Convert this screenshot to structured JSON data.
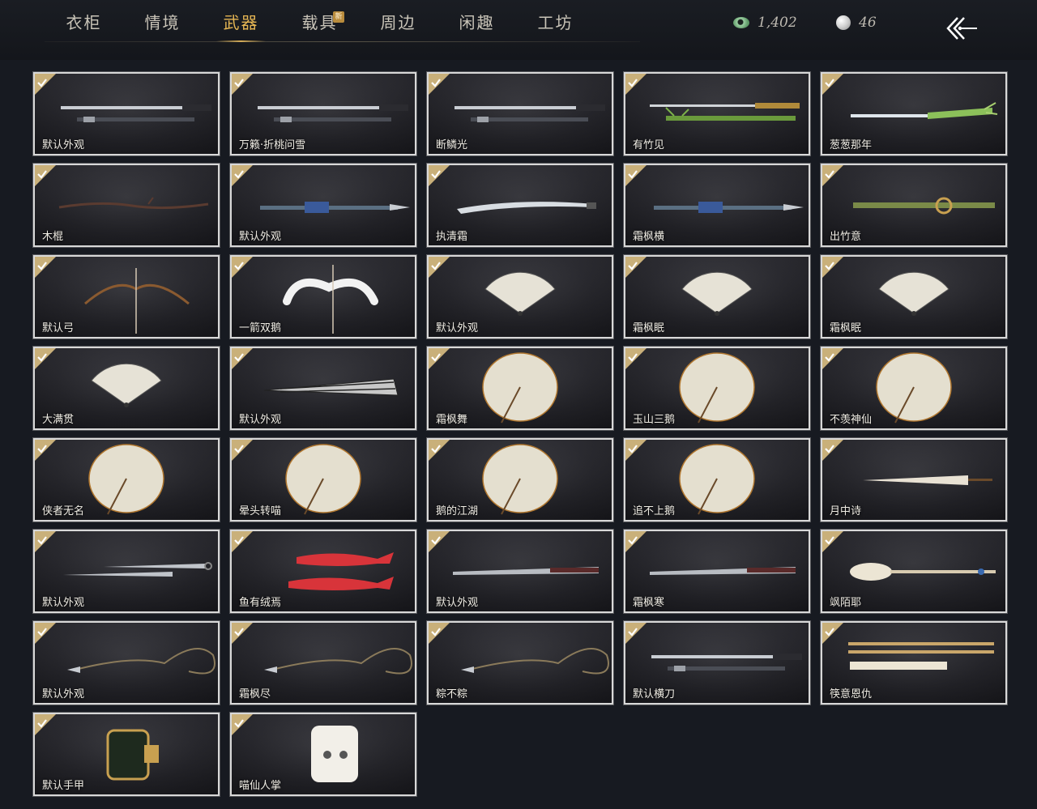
{
  "nav": {
    "tabs": [
      {
        "label": "衣柜"
      },
      {
        "label": "情境"
      },
      {
        "label": "武器"
      },
      {
        "label": "载具"
      },
      {
        "label": "周边"
      },
      {
        "label": "闲趣"
      },
      {
        "label": "工坊"
      }
    ],
    "active_index": 2,
    "new_badge": "新"
  },
  "currency": {
    "jade": "1,402",
    "pearl": "46"
  },
  "colors": {
    "accent": "#e6b653",
    "check": "#c9b07a",
    "card_border": "#d8d8d8"
  },
  "items": [
    {
      "name": "默认外观",
      "icon": "sword-icon"
    },
    {
      "name": "万籁·折桃问雪",
      "icon": "sword-icon"
    },
    {
      "name": "断鳞光",
      "icon": "sword-icon"
    },
    {
      "name": "有竹见",
      "icon": "bamboo-sword-icon"
    },
    {
      "name": "葱葱那年",
      "icon": "scallion-sword-icon"
    },
    {
      "name": "木棍",
      "icon": "stick-icon"
    },
    {
      "name": "默认外观",
      "icon": "spear-icon"
    },
    {
      "name": "执清霜",
      "icon": "frost-blade-icon"
    },
    {
      "name": "霜枫横",
      "icon": "spear-icon"
    },
    {
      "name": "出竹意",
      "icon": "bamboo-staff-icon"
    },
    {
      "name": "默认弓",
      "icon": "bow-icon"
    },
    {
      "name": "一箭双鹅",
      "icon": "goose-bow-icon"
    },
    {
      "name": "默认外观",
      "icon": "fan-icon"
    },
    {
      "name": "霜枫眠",
      "icon": "fan-icon"
    },
    {
      "name": "霜枫眠",
      "icon": "fan-icon"
    },
    {
      "name": "大满贯",
      "icon": "fan-icon"
    },
    {
      "name": "默认外观",
      "icon": "closed-fan-icon"
    },
    {
      "name": "霜枫舞",
      "icon": "umbrella-icon"
    },
    {
      "name": "玉山三鹅",
      "icon": "umbrella-icon"
    },
    {
      "name": "不羡神仙",
      "icon": "umbrella-icon"
    },
    {
      "name": "侠者无名",
      "icon": "umbrella-icon"
    },
    {
      "name": "晕头转喵",
      "icon": "umbrella-icon"
    },
    {
      "name": "鹅的江湖",
      "icon": "umbrella-icon"
    },
    {
      "name": "追不上鹅",
      "icon": "umbrella-icon"
    },
    {
      "name": "月中诗",
      "icon": "closed-umbrella-icon"
    },
    {
      "name": "默认外观",
      "icon": "dual-blades-icon"
    },
    {
      "name": "鱼有绒焉",
      "icon": "fish-blades-icon"
    },
    {
      "name": "默认外观",
      "icon": "long-blade-icon"
    },
    {
      "name": "霜枫寒",
      "icon": "long-blade-icon"
    },
    {
      "name": "飒陌耶",
      "icon": "spoon-staff-icon"
    },
    {
      "name": "默认外观",
      "icon": "rope-dart-icon"
    },
    {
      "name": "霜枫尽",
      "icon": "rope-dart-icon"
    },
    {
      "name": "粽不粽",
      "icon": "rope-dart-icon"
    },
    {
      "name": "默认横刀",
      "icon": "sword-icon"
    },
    {
      "name": "筷意恩仇",
      "icon": "chopsticks-icon"
    },
    {
      "name": "默认手甲",
      "icon": "gauntlet-icon"
    },
    {
      "name": "喵仙人掌",
      "icon": "cat-paw-icon"
    }
  ]
}
